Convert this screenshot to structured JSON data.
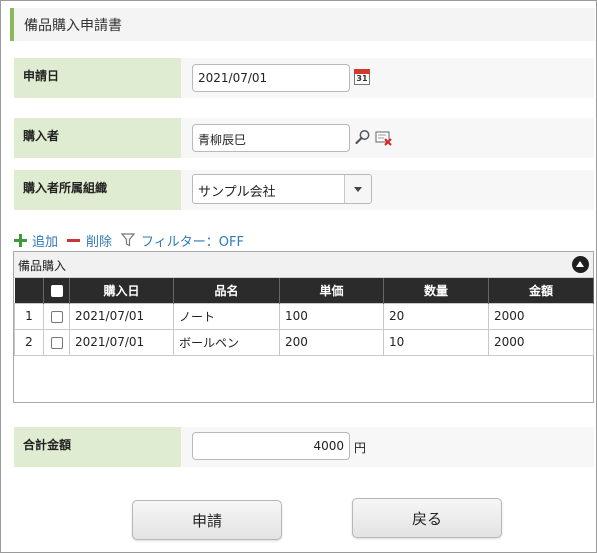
{
  "form": {
    "title": "備品購入申請書",
    "application_date": {
      "label": "申請日",
      "value": "2021/07/01",
      "calendar_day": "31"
    },
    "purchaser": {
      "label": "購入者",
      "value": "青柳辰巳"
    },
    "purchaser_org": {
      "label": "購入者所属組織",
      "value": "サンプル会社"
    },
    "total": {
      "label": "合計金額",
      "value": "4000",
      "unit": "円"
    }
  },
  "toolbar": {
    "add_label": "追加",
    "delete_label": "削除",
    "filter_label": "フィルター：OFF"
  },
  "grid": {
    "caption": "備品購入",
    "columns": [
      "",
      "",
      "購入日",
      "品名",
      "単価",
      "数量",
      "金額"
    ],
    "rows": [
      {
        "no": "1",
        "date": "2021/07/01",
        "item": "ノート",
        "price": "100",
        "qty": "20",
        "amount": "2000"
      },
      {
        "no": "2",
        "date": "2021/07/01",
        "item": "ボールペン",
        "price": "200",
        "qty": "10",
        "amount": "2000"
      }
    ]
  },
  "buttons": {
    "submit_label": "申請",
    "back_label": "戻る"
  },
  "colors": {
    "accent_green": "#8db85a",
    "label_bg": "#e0ecd1",
    "link_blue": "#2f7ab8",
    "header_dark": "#2b2b2b"
  }
}
